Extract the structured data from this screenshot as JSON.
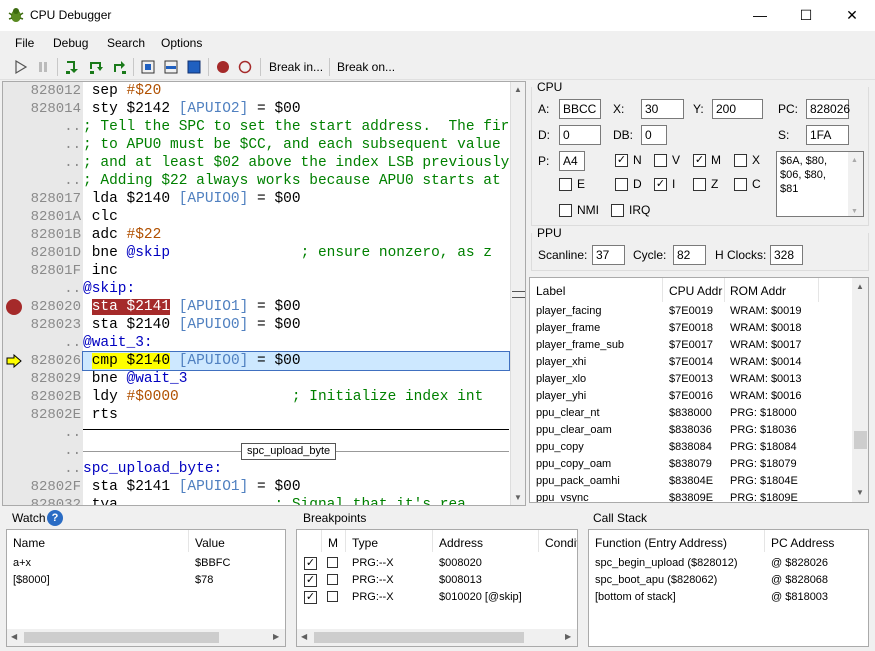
{
  "window": {
    "title": "CPU Debugger",
    "minimize": "—",
    "maximize": "☐",
    "close": "✕"
  },
  "menu": [
    "File",
    "Debug",
    "Search",
    "Options"
  ],
  "toolbar": {
    "break_in": "Break in...",
    "break_on": "Break on..."
  },
  "code": {
    "gutter": [
      "828012",
      "828014",
      "..",
      "..",
      "..",
      "..",
      "828017",
      "82801A",
      "82801B",
      "82801D",
      "82801F",
      "..",
      "828020",
      "828023",
      "..",
      "828026",
      "828029",
      "82802B",
      "82802E",
      "..",
      "..",
      "..",
      "82802F",
      "828032"
    ],
    "lines": [
      [
        {
          "t": " sep ",
          "c": ""
        },
        {
          "t": "#$20",
          "c": "num"
        }
      ],
      [
        {
          "t": " sty $2142 ",
          "c": ""
        },
        {
          "t": "[APUIO2]",
          "c": "ann"
        },
        {
          "t": " = $00",
          "c": ""
        }
      ],
      [
        {
          "t": "; Tell the SPC to set the start address.  The fir",
          "c": "cmt"
        }
      ],
      [
        {
          "t": "; to APU0 must be $CC, and each subsequent value",
          "c": "cmt"
        }
      ],
      [
        {
          "t": "; and at least $02 above the index LSB previously",
          "c": "cmt"
        }
      ],
      [
        {
          "t": "; Adding $22 always works because APU0 starts at",
          "c": "cmt"
        }
      ],
      [
        {
          "t": " lda $2140 ",
          "c": ""
        },
        {
          "t": "[APUIO0]",
          "c": "ann"
        },
        {
          "t": " = $00",
          "c": ""
        }
      ],
      [
        {
          "t": " clc",
          "c": ""
        }
      ],
      [
        {
          "t": " adc ",
          "c": ""
        },
        {
          "t": "#$22",
          "c": "num"
        }
      ],
      [
        {
          "t": " bne ",
          "c": ""
        },
        {
          "t": "@skip",
          "c": "lbl"
        },
        {
          "t": "               ",
          "c": ""
        },
        {
          "t": "; ensure nonzero, as z",
          "c": "cmt"
        }
      ],
      [
        {
          "t": " inc",
          "c": ""
        }
      ],
      [
        {
          "t": "@skip:",
          "c": "lbl"
        }
      ],
      [
        {
          "t": " ",
          "c": ""
        },
        {
          "t": "sta $2141",
          "c": "bp"
        },
        {
          "t": " ",
          "c": ""
        },
        {
          "t": "[APUIO1]",
          "c": "ann"
        },
        {
          "t": " = $00",
          "c": ""
        }
      ],
      [
        {
          "t": " sta $2140 ",
          "c": ""
        },
        {
          "t": "[APUIO0]",
          "c": "ann"
        },
        {
          "t": " = $00",
          "c": ""
        }
      ],
      [
        {
          "t": "@wait_3:",
          "c": "lbl"
        }
      ],
      [
        {
          "t": " ",
          "c": ""
        },
        {
          "t": "cmp $2140",
          "c": "cur"
        },
        {
          "t": " ",
          "c": ""
        },
        {
          "t": "[APUIO0]",
          "c": "ann"
        },
        {
          "t": " = $00",
          "c": ""
        }
      ],
      [
        {
          "t": " bne ",
          "c": ""
        },
        {
          "t": "@wait_3",
          "c": "lbl"
        }
      ],
      [
        {
          "t": " ldy ",
          "c": ""
        },
        {
          "t": "#$0000",
          "c": "num"
        },
        {
          "t": "             ",
          "c": ""
        },
        {
          "t": "; Initialize index int",
          "c": "cmt"
        }
      ],
      [
        {
          "t": " rts",
          "c": ""
        }
      ],
      [
        {
          "t": "",
          "c": ""
        }
      ],
      [
        {
          "t": "",
          "c": ""
        }
      ],
      [
        {
          "t": "spc_upload_byte:",
          "c": "lbl"
        }
      ],
      [
        {
          "t": " sta $2141 ",
          "c": ""
        },
        {
          "t": "[APUIO1]",
          "c": "ann"
        },
        {
          "t": " = $00",
          "c": ""
        }
      ],
      [
        {
          "t": " tya",
          "c": ""
        },
        {
          "t": "                  ",
          "c": ""
        },
        {
          "t": "; Signal that it's rea",
          "c": "cmt"
        }
      ]
    ],
    "separator_label": "spc_upload_byte"
  },
  "cpu": {
    "group": "CPU",
    "A_label": "A:",
    "A": "BBCC",
    "X_label": "X:",
    "X": "30",
    "Y_label": "Y:",
    "Y": "200",
    "PC_label": "PC:",
    "PC": "828026",
    "D_label": "D:",
    "D": "0",
    "DB_label": "DB:",
    "DB": "0",
    "S_label": "S:",
    "S": "1FA",
    "P_label": "P:",
    "P": "A4",
    "flags": [
      {
        "name": "N",
        "checked": true
      },
      {
        "name": "V",
        "checked": false
      },
      {
        "name": "M",
        "checked": true
      },
      {
        "name": "X",
        "checked": false
      },
      {
        "name": "E",
        "checked": false
      },
      {
        "name": "D",
        "checked": false
      },
      {
        "name": "I",
        "checked": true
      },
      {
        "name": "Z",
        "checked": false
      },
      {
        "name": "C",
        "checked": false
      },
      {
        "name": "NMI",
        "checked": false
      },
      {
        "name": "IRQ",
        "checked": false
      }
    ],
    "stack": "$6A, $80, $06, $80, $81"
  },
  "ppu": {
    "group": "PPU",
    "scanline_label": "Scanline:",
    "scanline": "37",
    "cycle_label": "Cycle:",
    "cycle": "82",
    "hclocks_label": "H Clocks:",
    "hclocks": "328"
  },
  "labels": {
    "headers": [
      "Label",
      "CPU Addr",
      "ROM Addr"
    ],
    "rows": [
      [
        "player_facing",
        "$7E0019",
        "WRAM: $0019"
      ],
      [
        "player_frame",
        "$7E0018",
        "WRAM: $0018"
      ],
      [
        "player_frame_sub",
        "$7E0017",
        "WRAM: $0017"
      ],
      [
        "player_xhi",
        "$7E0014",
        "WRAM: $0014"
      ],
      [
        "player_xlo",
        "$7E0013",
        "WRAM: $0013"
      ],
      [
        "player_yhi",
        "$7E0016",
        "WRAM: $0016"
      ],
      [
        "ppu_clear_nt",
        "$838000",
        "PRG: $18000"
      ],
      [
        "ppu_clear_oam",
        "$838036",
        "PRG: $18036"
      ],
      [
        "ppu_copy",
        "$838084",
        "PRG: $18084"
      ],
      [
        "ppu_copy_oam",
        "$838079",
        "PRG: $18079"
      ],
      [
        "ppu_pack_oamhi",
        "$83804E",
        "PRG: $1804E"
      ],
      [
        "ppu_vsync",
        "$83809E",
        "PRG: $1809E"
      ]
    ]
  },
  "watch": {
    "title": "Watch",
    "help": "?",
    "headers": [
      "Name",
      "Value"
    ],
    "rows": [
      [
        "a+x",
        "$BBFC"
      ],
      [
        "[$8000]",
        "$78"
      ]
    ]
  },
  "breakpoints": {
    "title": "Breakpoints",
    "headers": [
      "M",
      "Type",
      "Address",
      "Condit"
    ],
    "rows": [
      {
        "enabled": true,
        "mark": false,
        "type": "PRG:--X",
        "address": "$008020"
      },
      {
        "enabled": true,
        "mark": false,
        "type": "PRG:--X",
        "address": "$008013"
      },
      {
        "enabled": true,
        "mark": false,
        "type": "PRG:--X",
        "address": "$010020 [@skip]"
      }
    ]
  },
  "callstack": {
    "title": "Call Stack",
    "headers": [
      "Function (Entry Address)",
      "PC Address"
    ],
    "rows": [
      [
        "spc_begin_upload ($828012)",
        "@ $828026"
      ],
      [
        "spc_boot_apu ($828062)",
        "@ $828068"
      ],
      [
        "[bottom of stack]",
        "@ $818003"
      ]
    ]
  },
  "colors": {
    "breakpoint": "#a52a2a",
    "current_line": "#ffff00",
    "current_line_bg": "#cde8ff"
  }
}
